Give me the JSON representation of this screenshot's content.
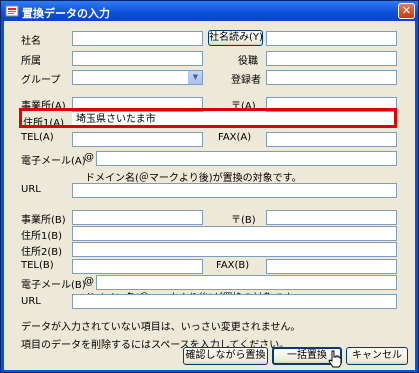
{
  "window": {
    "title": "置換データの入力",
    "close_glyph": "✕"
  },
  "header_fields": {
    "company_label": "社名",
    "company_reading_button": "社名読み(Y)",
    "department_label": "所属",
    "position_label": "役職",
    "group_label": "グループ",
    "registrant_label": "登録者"
  },
  "section_a": {
    "office_label": "事業所(A)",
    "postal_label": "〒(A)",
    "address1_label": "住所1(A)",
    "address1_value": "埼玉県さいたま市",
    "tel_label": "TEL(A)",
    "fax_label": "FAX(A)",
    "email_label": "電子メール(A)",
    "email_at": "@",
    "email_note": "ドメイン名(＠マークより後)が置換の対象です。",
    "url_label": "URL"
  },
  "section_b": {
    "office_label": "事業所(B)",
    "postal_label": "〒(B)",
    "address1_label": "住所1(B)",
    "address2_label": "住所2(B)",
    "tel_label": "TEL(B)",
    "fax_label": "FAX(B)",
    "email_label": "電子メール(B)",
    "email_at": "@",
    "email_note": "ドメイン名(＠マークより後)が置換の対象です。",
    "url_label": "URL"
  },
  "notes": {
    "line1": "データが入力されていない項目は、いっさい変更されません。",
    "line2": "項目のデータを削除するにはスペースを入力してください。"
  },
  "buttons": {
    "confirm_replace": "確認しながら置換",
    "bulk_replace": "一括置換",
    "cancel": "キャンセル"
  },
  "colors": {
    "highlight": "#e00000",
    "titlebar": "#0b4fd8"
  }
}
